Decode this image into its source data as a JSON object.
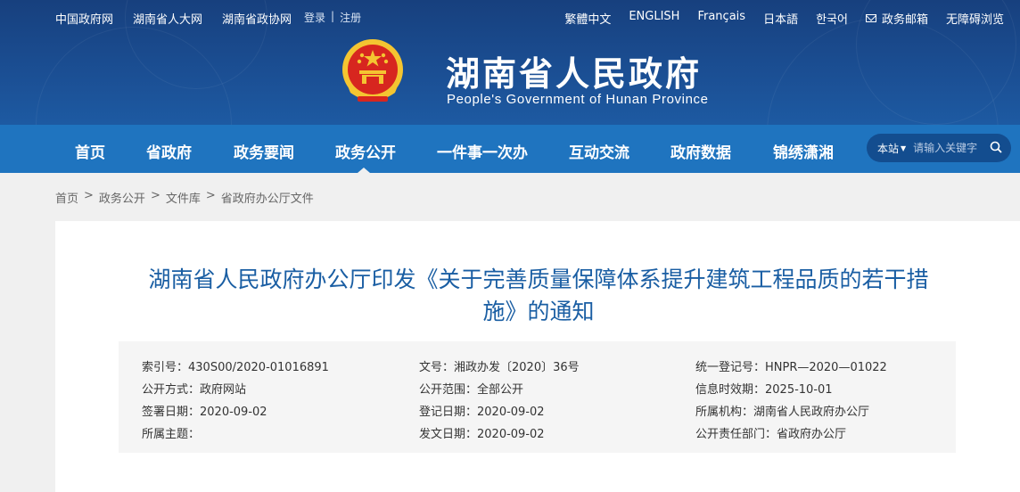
{
  "topbar": {
    "links": [
      "中国政府网",
      "湖南省人大网",
      "湖南省政协网"
    ],
    "login": "登录",
    "separator": "|",
    "register": "注册",
    "languages": [
      "繁體中文",
      "ENGLISH",
      "Français",
      "日本語",
      "한국어"
    ],
    "mailbox": "政务邮箱",
    "accessibility": "无障碍浏览"
  },
  "header": {
    "title": "湖南省人民政府",
    "subtitle": "People's Government of Hunan Province"
  },
  "nav": {
    "items": [
      "首页",
      "省政府",
      "政务要闻",
      "政务公开",
      "一件事一次办",
      "互动交流",
      "政府数据",
      "锦绣潇湘"
    ],
    "active": "政务公开",
    "search_scope": "本站",
    "search_placeholder": "请输入关键字"
  },
  "breadcrumb": [
    "首页",
    ">",
    "政务公开",
    ">",
    "文件库",
    ">",
    "省政府办公厅文件"
  ],
  "document": {
    "title_line1": "湖南省人民政府办公厅印发《关于完善质量保障体系提升建筑工程品质的若干措",
    "title_line2": "施》的通知",
    "meta": [
      [
        "索引号：430S00/2020-01016891",
        "文号：湘政办发〔2020〕36号",
        "统一登记号：HNPR—2020—01022"
      ],
      [
        "公开方式：政府网站",
        "公开范围：全部公开",
        "信息时效期：2025-10-01"
      ],
      [
        "签署日期：2020-09-02",
        "登记日期：2020-09-02",
        "所属机构：湖南省人民政府办公厅"
      ],
      [
        "所属主题：",
        "发文日期：2020-09-02",
        "公开责任部门：省政府办公厅"
      ]
    ]
  },
  "colors": {
    "header_bg": "#17407e",
    "nav_bg": "#1f74bf",
    "title_blue": "#1a5ea3",
    "emblem_red": "#d7261f",
    "emblem_gold": "#f4c531"
  }
}
